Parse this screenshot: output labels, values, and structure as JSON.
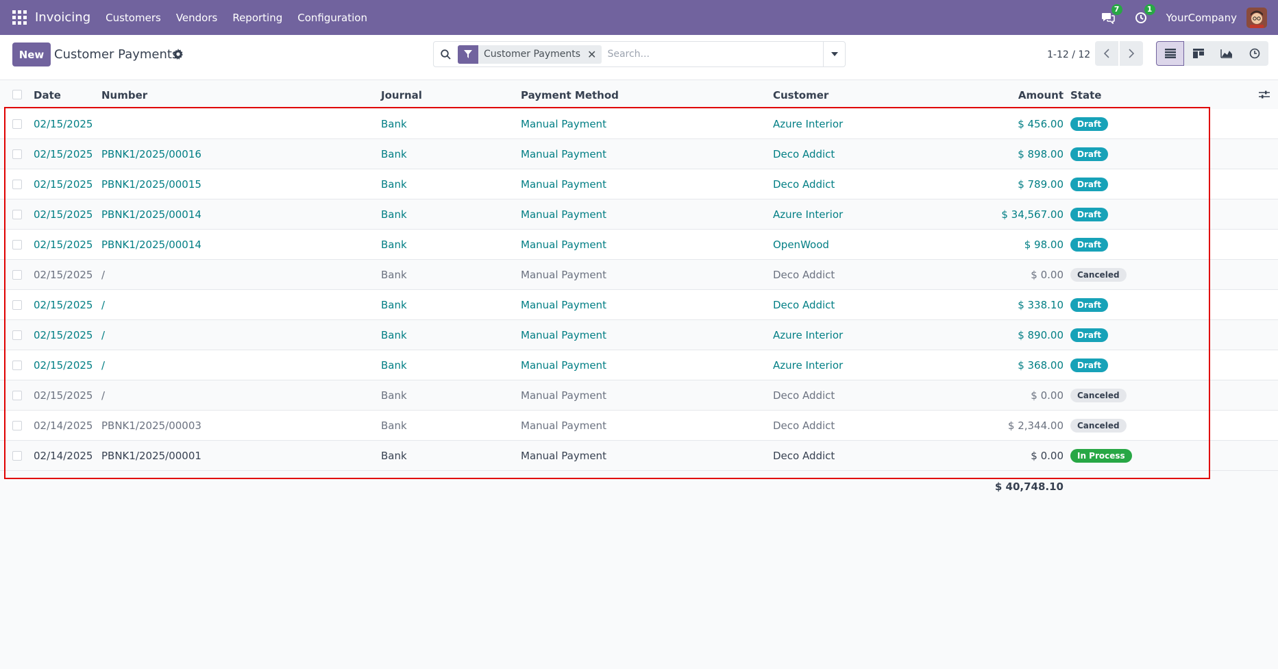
{
  "navbar": {
    "app_name": "Invoicing",
    "menu": [
      "Customers",
      "Vendors",
      "Reporting",
      "Configuration"
    ],
    "messages_count": "7",
    "activities_count": "1",
    "company": "YourCompany"
  },
  "control": {
    "new_label": "New",
    "title": "Customer Payments",
    "facet_label": "Customer Payments",
    "search_placeholder": "Search...",
    "pager": "1-12 / 12"
  },
  "table": {
    "headers": {
      "date": "Date",
      "number": "Number",
      "journal": "Journal",
      "method": "Payment Method",
      "customer": "Customer",
      "amount": "Amount",
      "state": "State"
    },
    "rows": [
      {
        "date": "02/15/2025",
        "number": "",
        "journal": "Bank",
        "method": "Manual Payment",
        "customer": "Azure Interior",
        "amount": "$ 456.00",
        "state": "Draft"
      },
      {
        "date": "02/15/2025",
        "number": "PBNK1/2025/00016",
        "journal": "Bank",
        "method": "Manual Payment",
        "customer": "Deco Addict",
        "amount": "$ 898.00",
        "state": "Draft"
      },
      {
        "date": "02/15/2025",
        "number": "PBNK1/2025/00015",
        "journal": "Bank",
        "method": "Manual Payment",
        "customer": "Deco Addict",
        "amount": "$ 789.00",
        "state": "Draft"
      },
      {
        "date": "02/15/2025",
        "number": "PBNK1/2025/00014",
        "journal": "Bank",
        "method": "Manual Payment",
        "customer": "Azure Interior",
        "amount": "$ 34,567.00",
        "state": "Draft"
      },
      {
        "date": "02/15/2025",
        "number": "PBNK1/2025/00014",
        "journal": "Bank",
        "method": "Manual Payment",
        "customer": "OpenWood",
        "amount": "$ 98.00",
        "state": "Draft"
      },
      {
        "date": "02/15/2025",
        "number": "/",
        "journal": "Bank",
        "method": "Manual Payment",
        "customer": "Deco Addict",
        "amount": "$ 0.00",
        "state": "Canceled"
      },
      {
        "date": "02/15/2025",
        "number": "/",
        "journal": "Bank",
        "method": "Manual Payment",
        "customer": "Deco Addict",
        "amount": "$ 338.10",
        "state": "Draft"
      },
      {
        "date": "02/15/2025",
        "number": "/",
        "journal": "Bank",
        "method": "Manual Payment",
        "customer": "Azure Interior",
        "amount": "$ 890.00",
        "state": "Draft"
      },
      {
        "date": "02/15/2025",
        "number": "/",
        "journal": "Bank",
        "method": "Manual Payment",
        "customer": "Azure Interior",
        "amount": "$ 368.00",
        "state": "Draft"
      },
      {
        "date": "02/15/2025",
        "number": "/",
        "journal": "Bank",
        "method": "Manual Payment",
        "customer": "Deco Addict",
        "amount": "$ 0.00",
        "state": "Canceled"
      },
      {
        "date": "02/14/2025",
        "number": "PBNK1/2025/00003",
        "journal": "Bank",
        "method": "Manual Payment",
        "customer": "Deco Addict",
        "amount": "$ 2,344.00",
        "state": "Canceled"
      },
      {
        "date": "02/14/2025",
        "number": "PBNK1/2025/00001",
        "journal": "Bank",
        "method": "Manual Payment",
        "customer": "Deco Addict",
        "amount": "$ 0.00",
        "state": "In Process"
      }
    ],
    "total": "$ 40,748.10"
  },
  "colors": {
    "brand": "#71639e",
    "link": "#017e84",
    "draft": "#17a2b8",
    "in_process": "#28a745",
    "highlight": "#e00000"
  }
}
